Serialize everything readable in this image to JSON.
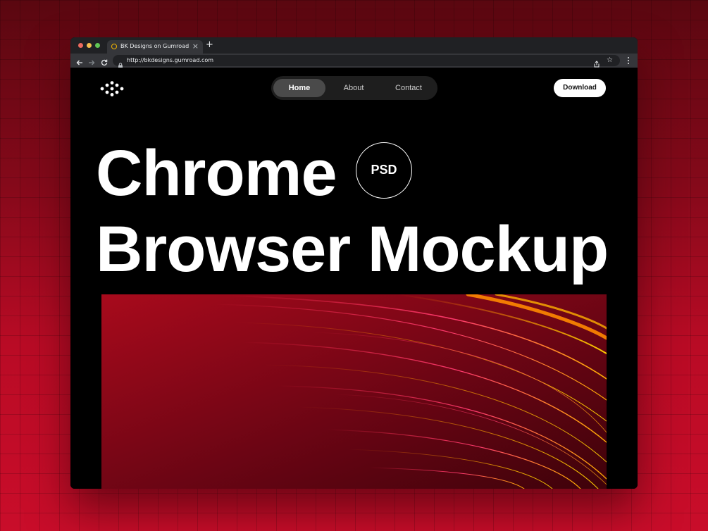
{
  "browser": {
    "tab": {
      "title": "BK Designs on Gumroad",
      "close_glyph": "×",
      "favicon": "gumroad-favicon"
    },
    "new_tab_glyph": "+",
    "address_bar": {
      "url": "http://bkdesigns.gumroad.com"
    },
    "icons": {
      "star_glyph": "☆"
    }
  },
  "site": {
    "nav": {
      "items": [
        {
          "label": "Home",
          "active": true
        },
        {
          "label": "About",
          "active": false
        },
        {
          "label": "Contact",
          "active": false
        }
      ]
    },
    "download_label": "Download",
    "hero": {
      "line1": "Chrome",
      "line2": "Browser Mockup",
      "badge": "PSD"
    }
  },
  "colors": {
    "background_top": "#5a0710",
    "background_bottom": "#c90d2a",
    "site_bg": "#000000",
    "chrome_tabbar": "#202124",
    "chrome_toolbar": "#35363a",
    "nav_active": "#4a4a4a",
    "accent_orange": "#ff8a00",
    "accent_pink": "#ff2a6a"
  }
}
